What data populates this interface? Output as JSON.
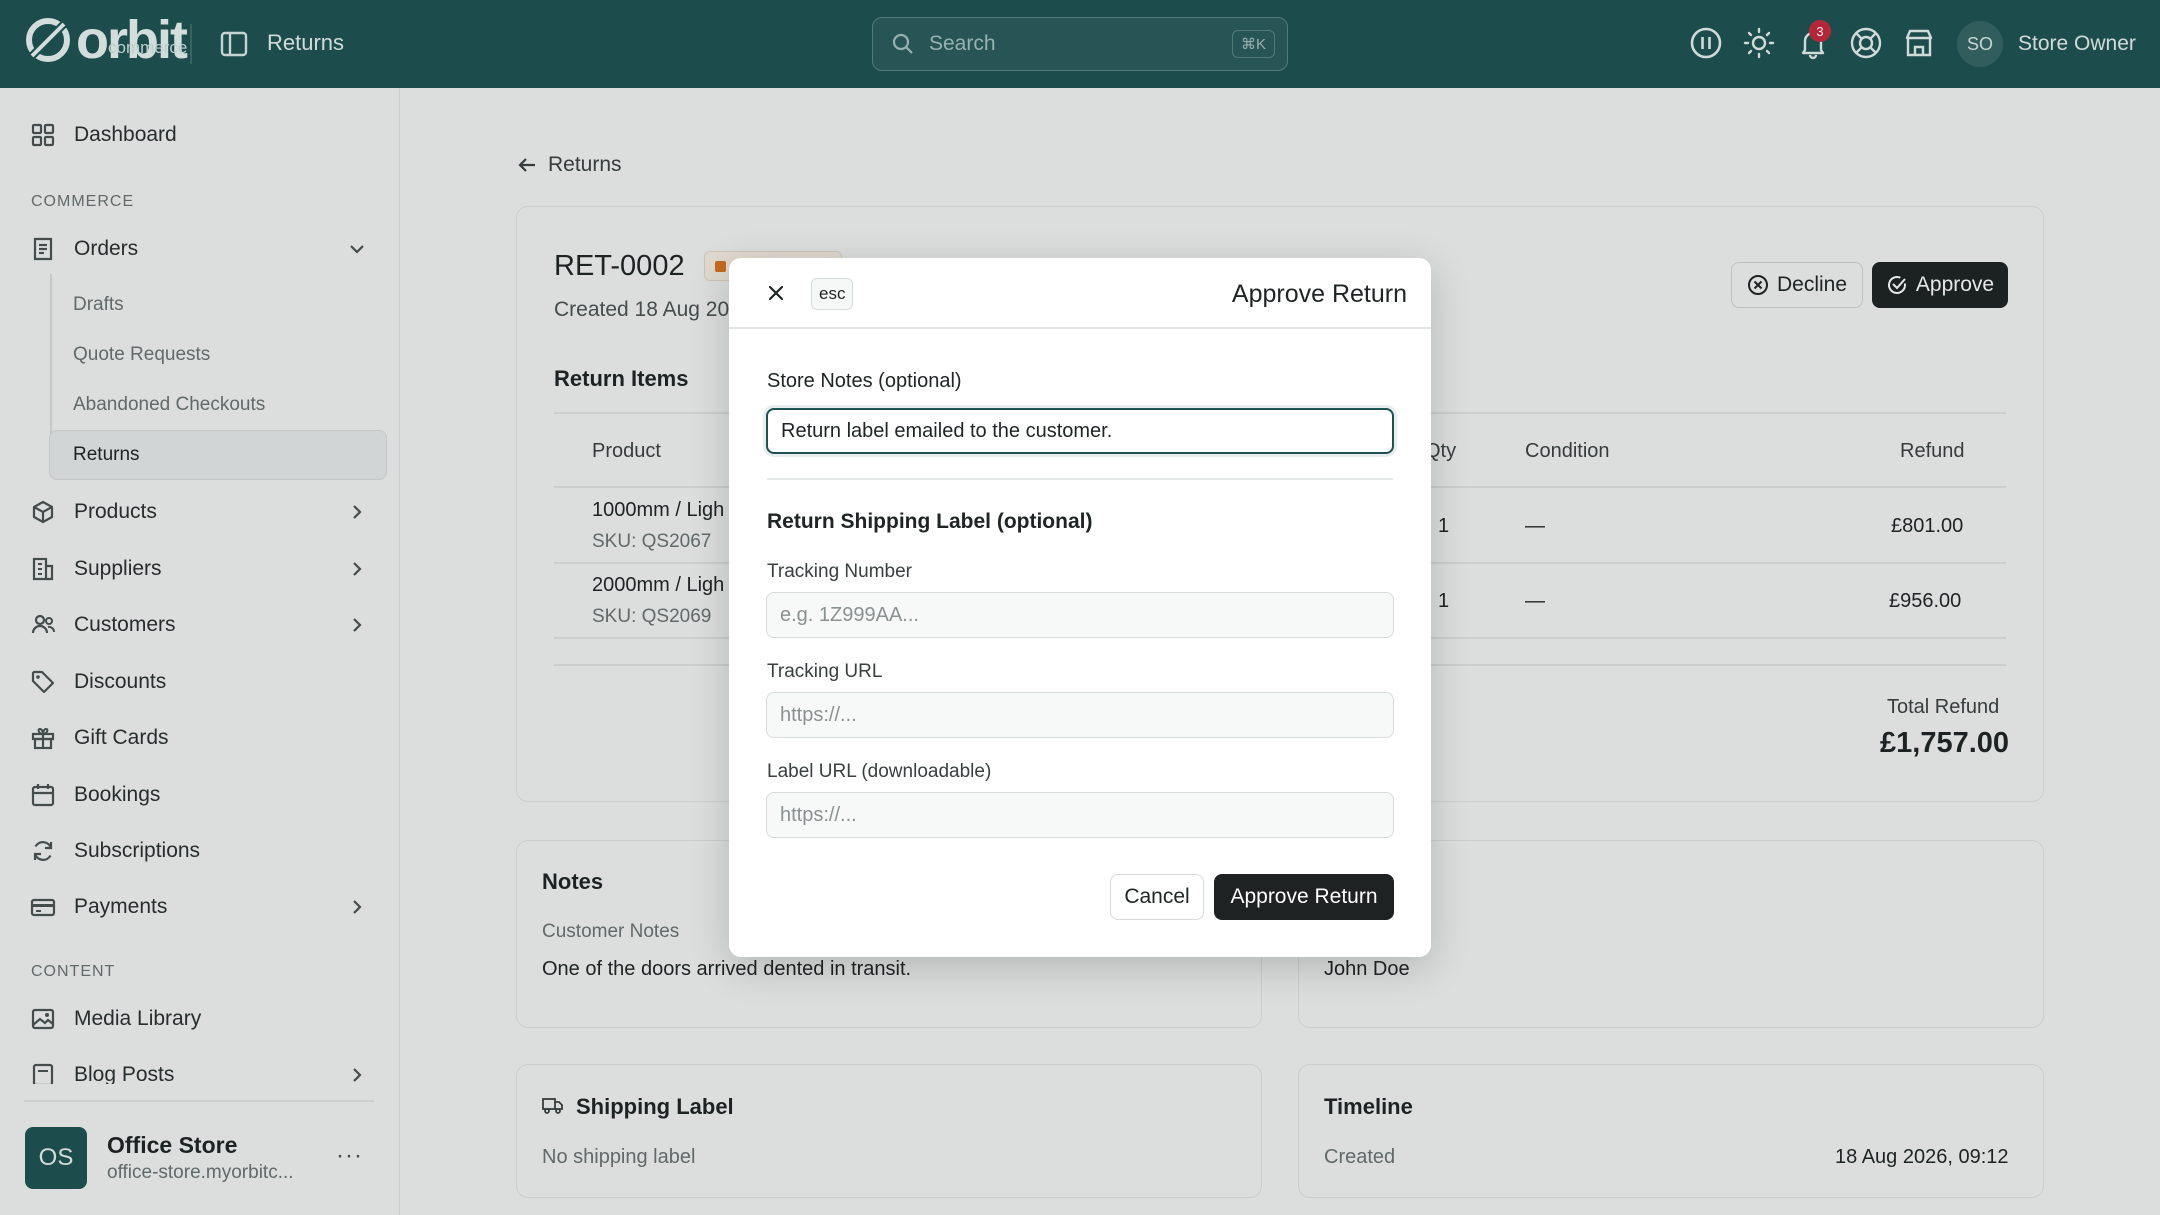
{
  "app": {
    "logo_word": "orbit",
    "logo_sub": "commerce",
    "page_title": "Returns",
    "search_placeholder": "Search",
    "search_shortcut": "⌘K",
    "notification_count": "3",
    "user_initials": "SO",
    "user_name": "Store Owner"
  },
  "sidebar": {
    "dashboard": "Dashboard",
    "section_commerce": "COMMERCE",
    "orders": "Orders",
    "orders_sub": [
      "Drafts",
      "Quote Requests",
      "Abandoned Checkouts",
      "Returns"
    ],
    "products": "Products",
    "suppliers": "Suppliers",
    "customers": "Customers",
    "discounts": "Discounts",
    "gift_cards": "Gift Cards",
    "bookings": "Bookings",
    "subscriptions": "Subscriptions",
    "payments": "Payments",
    "section_content": "CONTENT",
    "media_library": "Media Library",
    "blog_posts": "Blog Posts",
    "store_initials": "OS",
    "store_name": "Office Store",
    "store_url": "office-store.myorbitc...",
    "more": "···"
  },
  "main": {
    "back_label": "Returns",
    "return_id": "RET-0002",
    "created": "Created 18 Aug 20",
    "decline_label": "Decline",
    "approve_label": "Approve",
    "items_title": "Return Items",
    "columns": {
      "product": "Product",
      "qty": "Qty",
      "condition": "Condition",
      "refund": "Refund"
    },
    "rows": [
      {
        "product": "1000mm / Ligh",
        "sku": "SKU: QS2067",
        "qty": "1",
        "condition": "—",
        "refund": "£801.00"
      },
      {
        "product": "2000mm / Ligh",
        "sku": "SKU: QS2069",
        "qty": "1",
        "condition": "—",
        "refund": "£956.00"
      }
    ],
    "total_label": "Total Refund",
    "total_value": "£1,757.00",
    "notes_title": "Notes",
    "customer_notes_label": "Customer Notes",
    "customer_notes": "One of the doors arrived dented in transit.",
    "customer_name": "John Doe",
    "shipping_title": "Shipping Label",
    "shipping_empty": "No shipping label",
    "timeline_title": "Timeline",
    "timeline_event": "Created",
    "timeline_date": "18 Aug 2026, 09:12"
  },
  "modal": {
    "esc": "esc",
    "title": "Approve Return",
    "store_notes_label": "Store Notes (optional)",
    "store_notes_value": "Return label emailed to the customer.",
    "section_title": "Return Shipping Label (optional)",
    "tracking_number_label": "Tracking Number",
    "tracking_number_placeholder": "e.g. 1Z999AA...",
    "tracking_url_label": "Tracking URL",
    "tracking_url_placeholder": "https://...",
    "label_url_label": "Label URL (downloadable)",
    "label_url_placeholder": "https://...",
    "cancel_label": "Cancel",
    "confirm_label": "Approve Return"
  },
  "colors": {
    "topbar": "#1f5252",
    "primary_button": "#1e2222",
    "badge": "#c6293b",
    "status_dot": "#d9731f"
  }
}
